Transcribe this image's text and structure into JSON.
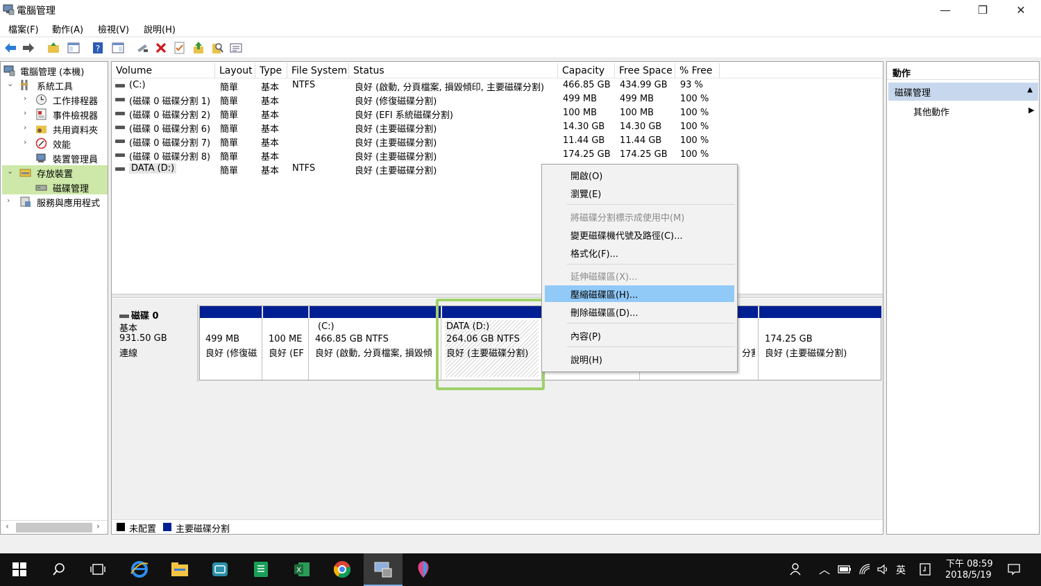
{
  "window": {
    "title": "電腦管理",
    "minimize_glyph": "—",
    "maximize_glyph": "❐",
    "close_glyph": "✕"
  },
  "menu": {
    "file": "檔案(F)",
    "action": "動作(A)",
    "view": "檢視(V)",
    "help": "說明(H)"
  },
  "toolbar": {
    "icons": [
      "back-arrow-icon",
      "forward-arrow-icon",
      "up-folder-icon",
      "show-hide-tree-icon",
      "help-icon",
      "console-icon",
      "connect-drive-icon",
      "delete-icon",
      "check-icon",
      "export-icon",
      "search-icon",
      "properties-icon"
    ]
  },
  "tree": {
    "root": "電腦管理 (本機)",
    "system_tools": "系統工具",
    "task_scheduler": "工作排程器",
    "event_viewer": "事件檢視器",
    "shared_folders": "共用資料夾",
    "performance": "效能",
    "device_manager": "裝置管理員",
    "storage": "存放裝置",
    "disk_management": "磁碟管理",
    "services_apps": "服務與應用程式"
  },
  "volume_table": {
    "headers": {
      "volume": "Volume",
      "layout": "Layout",
      "type": "Type",
      "fs": "File System",
      "status": "Status",
      "capacity": "Capacity",
      "free": "Free Space",
      "pct": "% Free"
    },
    "rows": [
      {
        "volume": "(C:)",
        "layout": "簡單",
        "type": "基本",
        "fs": "NTFS",
        "status": "良好 (啟動, 分頁檔案, 損毀傾印, 主要磁碟分割)",
        "capacity": "466.85 GB",
        "free": "434.99 GB",
        "pct": "93 %"
      },
      {
        "volume": "(磁碟 0 磁碟分割 1)",
        "layout": "簡單",
        "type": "基本",
        "fs": "",
        "status": "良好 (修復磁碟分割)",
        "capacity": "499 MB",
        "free": "499 MB",
        "pct": "100 %"
      },
      {
        "volume": "(磁碟 0 磁碟分割 2)",
        "layout": "簡單",
        "type": "基本",
        "fs": "",
        "status": "良好 (EFI 系統磁碟分割)",
        "capacity": "100 MB",
        "free": "100 MB",
        "pct": "100 %"
      },
      {
        "volume": "(磁碟 0 磁碟分割 6)",
        "layout": "簡單",
        "type": "基本",
        "fs": "",
        "status": "良好 (主要磁碟分割)",
        "capacity": "14.30 GB",
        "free": "14.30 GB",
        "pct": "100 %"
      },
      {
        "volume": "(磁碟 0 磁碟分割 7)",
        "layout": "簡單",
        "type": "基本",
        "fs": "",
        "status": "良好 (主要磁碟分割)",
        "capacity": "11.44 GB",
        "free": "11.44 GB",
        "pct": "100 %"
      },
      {
        "volume": "(磁碟 0 磁碟分割 8)",
        "layout": "簡單",
        "type": "基本",
        "fs": "",
        "status": "良好 (主要磁碟分割)",
        "capacity": "174.25 GB",
        "free": "174.25 GB",
        "pct": "100 %"
      },
      {
        "volume": "DATA (D:)",
        "layout": "簡單",
        "type": "基本",
        "fs": "NTFS",
        "status": "良好 (主要磁碟分割)",
        "capacity": "",
        "free": "",
        "pct": ""
      }
    ]
  },
  "disk": {
    "name": "磁碟 0",
    "kind": "基本",
    "size": "931.50 GB",
    "state": "連線"
  },
  "partitions": {
    "p1": {
      "size": "499 MB",
      "status": "良好 (修復磁"
    },
    "p2": {
      "size": "100 ME",
      "status": "良好 (EF"
    },
    "c": {
      "name": "(C:)",
      "size": "466.85 GB NTFS",
      "status": "良好 (啟動, 分頁檔案, 損毀傾"
    },
    "d": {
      "name": "DATA  (D:)",
      "size": "264.06 GB NTFS",
      "status": "良好 (主要磁碟分割)"
    },
    "p7_status_tail": "分割",
    "p8": {
      "size": "174.25 GB",
      "status": "良好 (主要磁碟分割)"
    }
  },
  "legend": {
    "unallocated": "未配置",
    "primary": "主要磁碟分割",
    "unallocated_color": "#000000",
    "primary_color": "#001f93"
  },
  "actions": {
    "header": "動作",
    "section": "磁碟管理",
    "more": "其他動作"
  },
  "context_menu": {
    "open": "開啟(O)",
    "explore": "瀏覽(E)",
    "mark_active": "將磁碟分割標示成使用中(M)",
    "change_letter": "變更磁碟機代號及路徑(C)...",
    "format": "格式化(F)...",
    "extend": "延伸磁碟區(X)...",
    "shrink": "壓縮磁碟區(H)...",
    "delete": "刪除磁碟區(D)...",
    "properties": "內容(P)",
    "help": "說明(H)"
  },
  "taskbar": {
    "clock_time": "下午 08:59",
    "clock_date": "2018/5/19",
    "ime": "英",
    "chevron_glyph": "︿"
  },
  "colors": {
    "accent_selection": "#cde8a8",
    "highlight_frame": "#9fd16a",
    "menu_highlight": "#91c9f7",
    "partition_bar": "#001f93"
  }
}
